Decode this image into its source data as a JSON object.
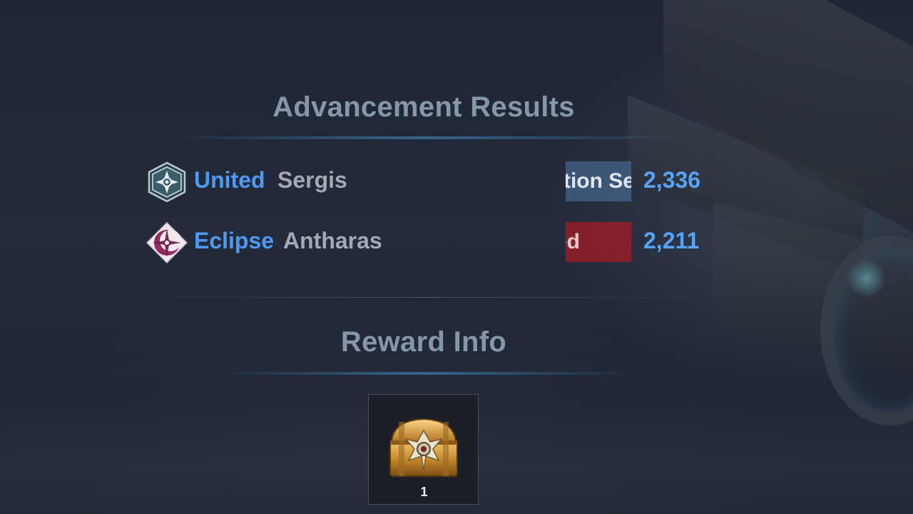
{
  "screen": {
    "advancement_title": "Advancement Results",
    "reward_title": "Reward Info"
  },
  "results": [
    {
      "faction": "United",
      "server": "Sergis",
      "status_text": "tion Se",
      "score": "2,336",
      "emblem_icon": "united-emblem-icon",
      "status_color": "#46648c"
    },
    {
      "faction": "Eclipse",
      "server": "Antharas",
      "status_text": "ed",
      "score": "2,211",
      "emblem_icon": "eclipse-emblem-icon",
      "status_color": "#961e28"
    }
  ],
  "reward": {
    "item_icon": "treasure-chest-icon",
    "quantity": "1"
  },
  "colors": {
    "accent_blue": "#4f9af0",
    "score_blue": "#57a3f5",
    "heading": "#8697ab",
    "server_text": "#a3a8b2"
  }
}
